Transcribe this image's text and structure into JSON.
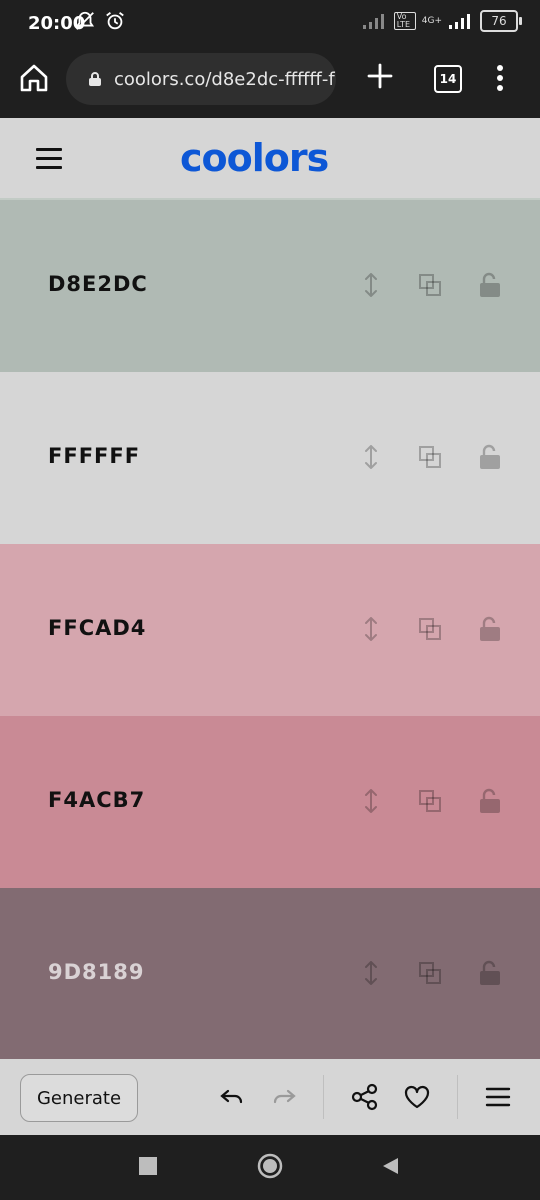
{
  "status_bar": {
    "time": "20:00",
    "battery": "76",
    "network": "4G+",
    "volte": "Vo LTE",
    "icons": [
      "mute-notification-icon",
      "alarm-icon",
      "signal-icon",
      "signal-icon",
      "battery-icon"
    ]
  },
  "browser": {
    "url": "coolors.co/d8e2dc-ffffff-f",
    "tab_count": "14",
    "icons": [
      "home-icon",
      "lock-icon",
      "plus-icon",
      "more-icon"
    ]
  },
  "app": {
    "logo": "coolors",
    "colors": {
      "brand": "#0d57d6"
    }
  },
  "palette": [
    {
      "hex": "D8E2DC",
      "bg": "#b0bab4",
      "text_color": "#111111"
    },
    {
      "hex": "FFFFFF",
      "bg": "#d6d6d6",
      "text_color": "#111111"
    },
    {
      "hex": "FFCAD4",
      "bg": "#d5a6ae",
      "text_color": "#111111"
    },
    {
      "hex": "F4ACB7",
      "bg": "#c98a95",
      "text_color": "#111111"
    },
    {
      "hex": "9D8189",
      "bg": "#826b72",
      "text_color": "#d9d2d4"
    }
  ],
  "swatch_icons": [
    "drag-icon",
    "copy-icon",
    "lock-icon"
  ],
  "bottom_bar": {
    "generate_label": "Generate",
    "icons": [
      "undo-icon",
      "redo-icon",
      "share-icon",
      "heart-icon",
      "menu-icon"
    ]
  },
  "nav_bar": {
    "icons": [
      "recents-icon",
      "home-nav-icon",
      "back-icon"
    ]
  }
}
